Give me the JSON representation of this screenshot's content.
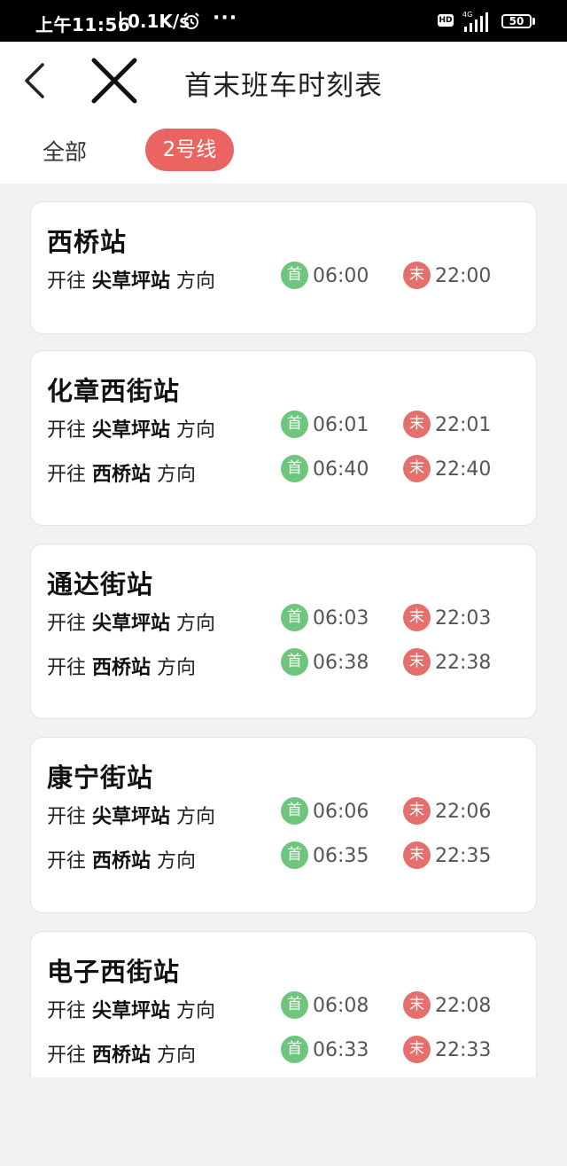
{
  "status_bar": {
    "time": "上午11:56",
    "speed": "0.1K/s",
    "dots": "···",
    "hd": "HD",
    "battery": "50"
  },
  "header": {
    "title": "首末班车时刻表",
    "tabs": [
      {
        "label": "全部",
        "active": false
      },
      {
        "label": "2号线",
        "active": true
      }
    ]
  },
  "labels": {
    "first": "首",
    "last": "末",
    "heading_prefix": "开往",
    "heading_suffix": "方向"
  },
  "stations": [
    {
      "name": "西桥站",
      "directions": [
        {
          "to": "尖草坪站",
          "first": "06:00",
          "last": "22:00"
        }
      ]
    },
    {
      "name": "化章西街站",
      "directions": [
        {
          "to": "尖草坪站",
          "first": "06:01",
          "last": "22:01"
        },
        {
          "to": "西桥站",
          "first": "06:40",
          "last": "22:40"
        }
      ]
    },
    {
      "name": "通达街站",
      "directions": [
        {
          "to": "尖草坪站",
          "first": "06:03",
          "last": "22:03"
        },
        {
          "to": "西桥站",
          "first": "06:38",
          "last": "22:38"
        }
      ]
    },
    {
      "name": "康宁街站",
      "directions": [
        {
          "to": "尖草坪站",
          "first": "06:06",
          "last": "22:06"
        },
        {
          "to": "西桥站",
          "first": "06:35",
          "last": "22:35"
        }
      ]
    },
    {
      "name": "电子西街站",
      "directions": [
        {
          "to": "尖草坪站",
          "first": "06:08",
          "last": "22:08"
        },
        {
          "to": "西桥站",
          "first": "06:33",
          "last": "22:33"
        }
      ]
    }
  ],
  "colors": {
    "accent": "#ea6461",
    "first_badge": "#6ec57c",
    "last_badge": "#e56f6c"
  }
}
